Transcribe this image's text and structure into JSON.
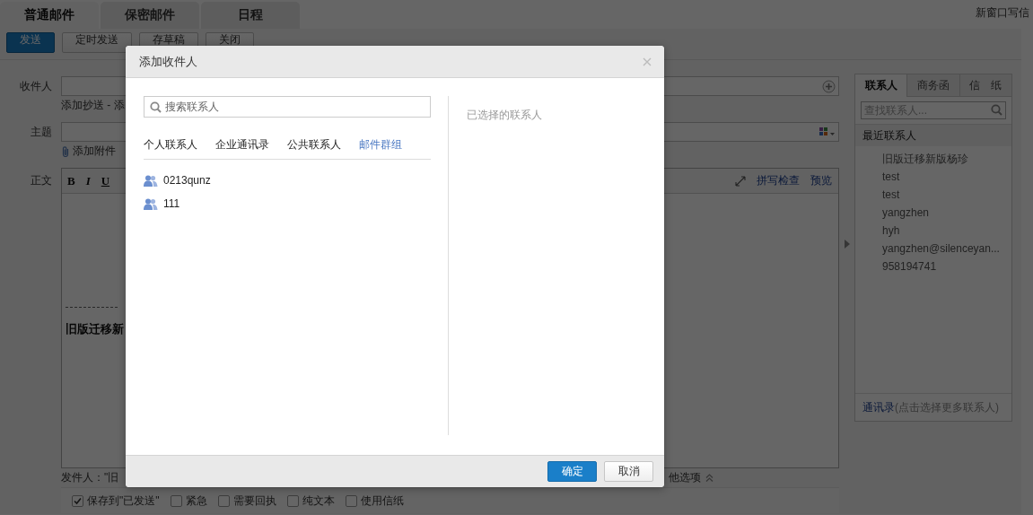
{
  "top_tabs": [
    {
      "label": "普通邮件",
      "selected": true
    },
    {
      "label": "保密邮件",
      "selected": false
    },
    {
      "label": "日程",
      "selected": false
    }
  ],
  "new_window_link": "新窗口写信",
  "toolbar": [
    {
      "label": "发送",
      "kind": "primary"
    },
    {
      "label": "定时发送",
      "kind": "normal"
    },
    {
      "label": "存草稿",
      "kind": "normal"
    },
    {
      "label": "关闭",
      "kind": "normal"
    }
  ],
  "form": {
    "to_label": "收件人",
    "cc_links": "添加抄送 - 添",
    "subject_label": "主题",
    "attach_link": "添加附件",
    "body_label": "正文",
    "format_buttons": [
      "B",
      "I",
      "U"
    ],
    "spellcheck": "拼写检查",
    "preview": "预览",
    "signature": "旧版迁移新",
    "sender": "发件人：\"旧",
    "more_options": "他选项"
  },
  "options": [
    {
      "label": "保存到\"已发送\"",
      "checked": true
    },
    {
      "label": "紧急",
      "checked": false
    },
    {
      "label": "需要回执",
      "checked": false
    },
    {
      "label": "纯文本",
      "checked": false
    },
    {
      "label": "使用信纸",
      "checked": false
    }
  ],
  "side_panel": {
    "tabs": [
      {
        "label": "联系人",
        "selected": true
      },
      {
        "label": "商务函",
        "selected": false
      },
      {
        "label": "信　纸",
        "selected": false
      }
    ],
    "search_placeholder": "查找联系人...",
    "section": "最近联系人",
    "contacts": [
      "旧版迁移新版杨珍",
      "test",
      "test",
      "yangzhen",
      "hyh",
      "yangzhen@silenceyan...",
      "958194741"
    ],
    "footer_link": "通讯录",
    "footer_hint": "(点击选择更多联系人)"
  },
  "dialog": {
    "title": "添加收件人",
    "search_placeholder": "搜索联系人",
    "tabs": [
      {
        "label": "个人联系人",
        "selected": false
      },
      {
        "label": "企业通讯录",
        "selected": false
      },
      {
        "label": "公共联系人",
        "selected": false
      },
      {
        "label": "邮件群组",
        "selected": true
      }
    ],
    "groups": [
      "0213qunz",
      "111"
    ],
    "selected_heading": "已选择的联系人",
    "buttons": [
      {
        "label": "确定",
        "kind": "primary"
      },
      {
        "label": "取消",
        "kind": "normal"
      }
    ]
  }
}
